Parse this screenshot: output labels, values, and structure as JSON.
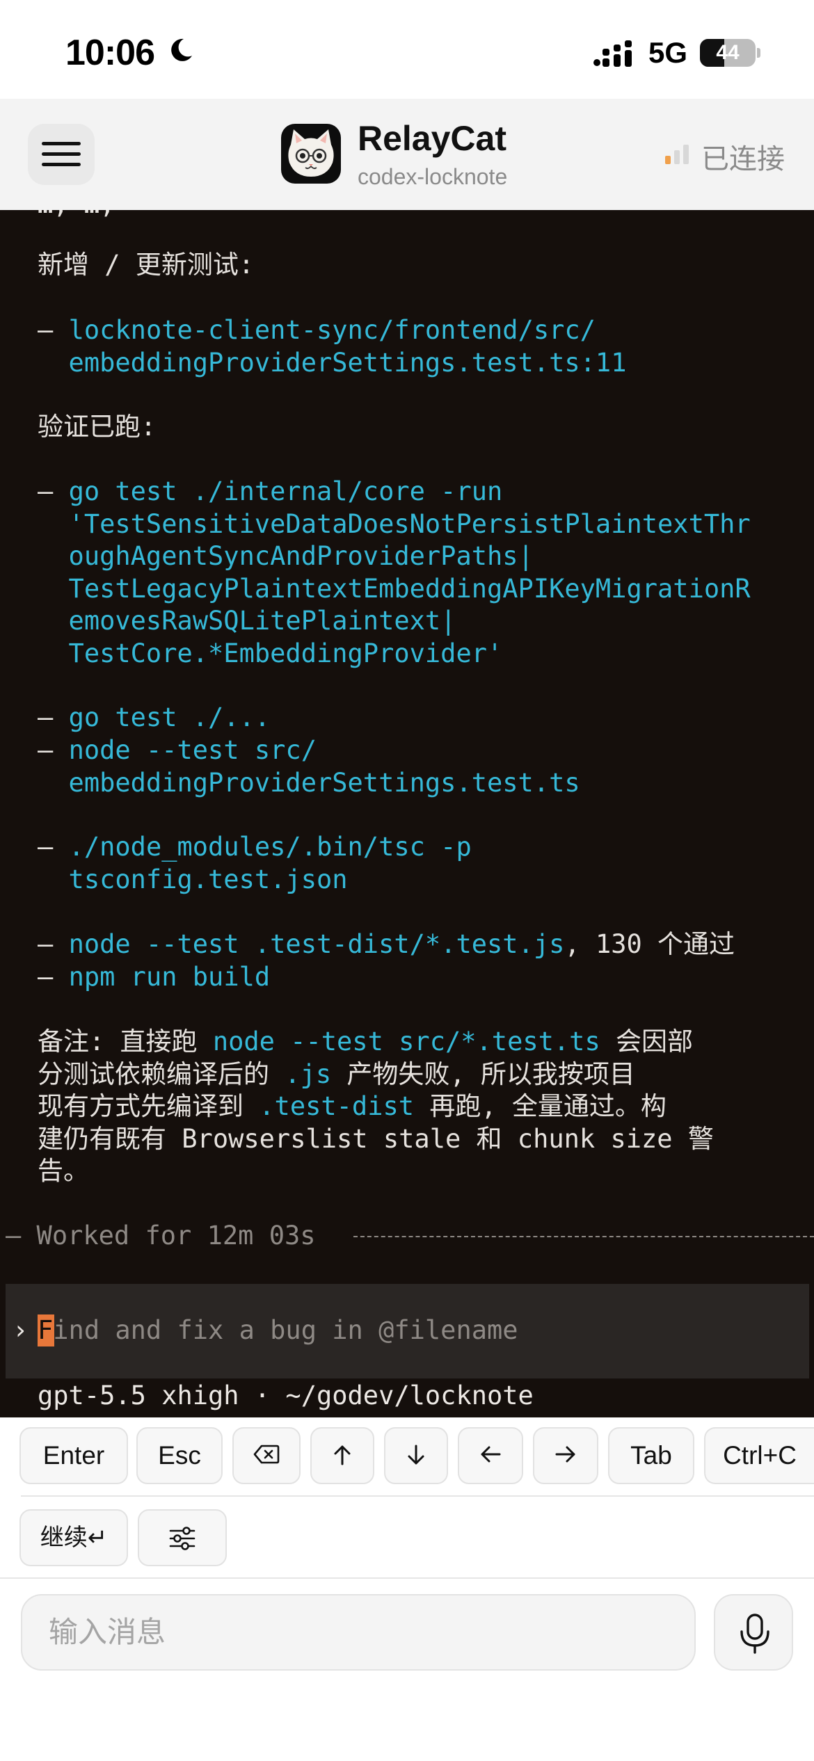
{
  "status_bar": {
    "time": "10:06",
    "network": "5G",
    "battery_level": "44",
    "battery_fraction": 0.44,
    "icons": [
      "moon-icon",
      "signal-icon",
      "battery-icon"
    ]
  },
  "header": {
    "menu_icon": "hamburger-menu-icon",
    "app_name": "RelayCat",
    "session_name": "codex-locknote",
    "connection_status": "已连接",
    "accent_color": "#f0a04b"
  },
  "terminal": {
    "lines": {
      "cut_top": "…, …,",
      "tests_heading": "新增 / 更新测试:",
      "test_file_bullet": "– ",
      "test_file": "locknote-client-sync/frontend/src/\n  embeddingProviderSettings.test.ts:11",
      "verified_heading": "验证已跑:",
      "cmd1_bullet": "– ",
      "cmd1": "go test ./internal/core -run\n  'TestSensitiveDataDoesNotPersistPlaintextThr\n  oughAgentSyncAndProviderPaths|\n  TestLegacyPlaintextEmbeddingAPIKeyMigrationR\n  emovesRawSQLitePlaintext|\n  TestCore.*EmbeddingProvider'",
      "cmd2": "go test ./...",
      "cmd3": "node --test src/\n  embeddingProviderSettings.test.ts",
      "cmd4": "./node_modules/.bin/tsc -p\n  tsconfig.test.json",
      "cmd5": "node --test .test-dist/*.test.js",
      "cmd5_result": ", 130 个通过",
      "cmd6": "npm run build",
      "note_prefix": "备注: 直接跑 ",
      "note_cmd": "node --test src/*.test.ts",
      "note_mid1": " 会因部\n分测试依赖编译后的 ",
      "note_js": ".js",
      "note_mid2": " 产物失败, 所以我按项目\n现有方式先编译到 ",
      "note_dist": ".test-dist",
      "note_end": " 再跑, 全量通过。构\n建仍有既有 Browserslist stale 和 chunk size 警\n告。"
    },
    "worked_label": "— Worked for 12m 03s ",
    "prompt_chevron": "›",
    "prompt_placeholder": "Find and fix a bug in @filename",
    "prompt_cursor_char": "F",
    "model_line": "gpt-5.5 xhigh · ~/godev/locknote",
    "colors": {
      "background": "#150f0c",
      "command": "#36b9d8",
      "text": "#e6e2de",
      "cursor": "#e8773a"
    }
  },
  "keys": {
    "enter": "Enter",
    "esc": "Esc",
    "backspace_icon": "backspace-icon",
    "up_icon": "arrow-up-icon",
    "down_icon": "arrow-down-icon",
    "left_icon": "arrow-left-icon",
    "right_icon": "arrow-right-icon",
    "tab": "Tab",
    "ctrl_c": "Ctrl+C",
    "continue": "继续↵",
    "settings_icon": "sliders-icon"
  },
  "input_bar": {
    "placeholder": "输入消息",
    "mic_icon": "microphone-icon"
  }
}
